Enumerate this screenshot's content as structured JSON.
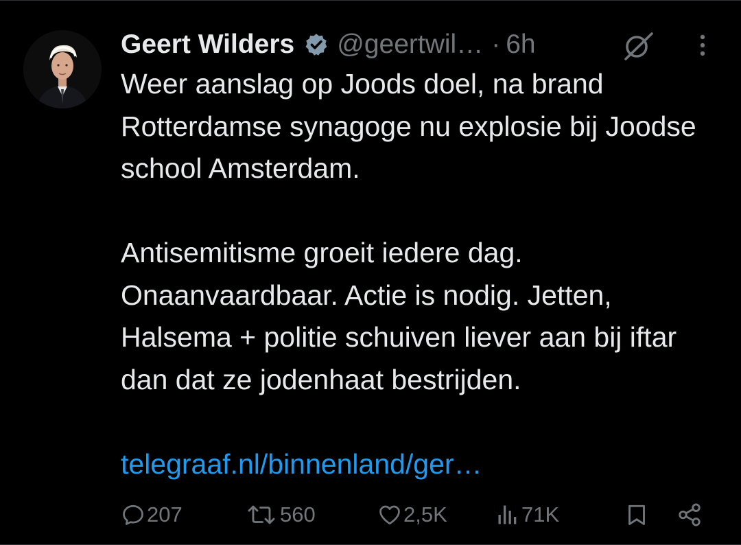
{
  "tweet": {
    "author_name": "Geert Wilders",
    "handle": "@geertwil…",
    "separator": "·",
    "time": "6h",
    "paragraphs": [
      "Weer aanslag op Joods doel, na brand Rotterdamse synagoge nu explosie bij Joodse school Amsterdam.",
      "Antisemitisme groeit iedere dag. Onaanvaardbaar. Actie is nodig. Jetten, Halsema + politie schuiven liever aan bij iftar dan dat ze jodenhaat bestrijden."
    ],
    "link_text": "telegraaf.nl/binnenland/ger…"
  },
  "actions": {
    "replies": "207",
    "reposts": "560",
    "likes": "2,5K",
    "views": "71K"
  },
  "icons": {
    "verified": "verified-badge-icon",
    "grok": "grok-icon",
    "more": "more-vertical-icon",
    "reply": "reply-icon",
    "repost": "repost-icon",
    "like": "heart-icon",
    "views": "views-icon",
    "bookmark": "bookmark-icon",
    "share": "share-icon"
  },
  "colors": {
    "background": "#000000",
    "text": "#e7e9ea",
    "secondary": "#71767b",
    "link": "#1d9bf0"
  }
}
